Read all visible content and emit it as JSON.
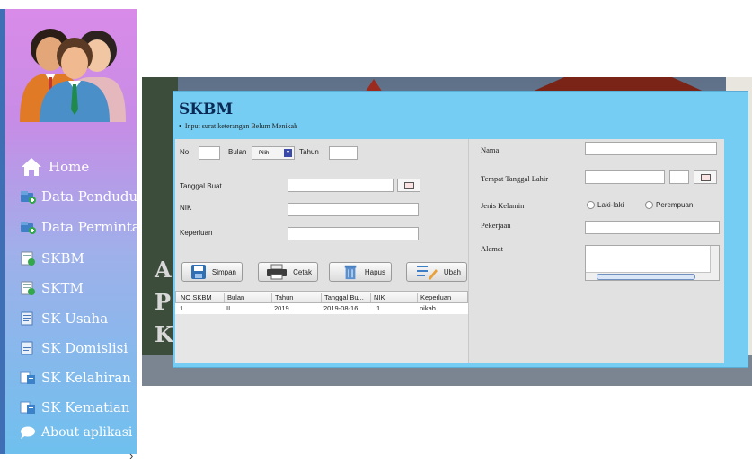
{
  "sidebar": {
    "items": [
      {
        "label": "Home",
        "icon": "home-icon"
      },
      {
        "label": "Data Penduduk",
        "icon": "add-user-icon"
      },
      {
        "label": "Data Permintaan",
        "icon": "add-request-icon"
      },
      {
        "label": "SKBM",
        "icon": "document-icon"
      },
      {
        "label": "SKTM",
        "icon": "document-icon"
      },
      {
        "label": "SK Usaha",
        "icon": "form-icon"
      },
      {
        "label": "SK Domislisi",
        "icon": "form-icon"
      },
      {
        "label": "SK Kelahiran",
        "icon": "birth-icon"
      },
      {
        "label": "SK Kematian",
        "icon": "death-icon"
      },
      {
        "label": "About aplikasi",
        "icon": "chat-bubble-icon"
      }
    ],
    "collapse_label": "›"
  },
  "background": {
    "letters": [
      "A",
      "P",
      "K"
    ]
  },
  "form": {
    "title": "SKBM",
    "subtitle": "Input surat keterangan Belum Menikah",
    "left": {
      "no_label": "No",
      "bulan_label": "Bulan",
      "bulan_value": "--Pilih--",
      "tahun_label": "Tahun",
      "tanggal_buat_label": "Tanggal Buat",
      "nik_label": "NIK",
      "keperluan_label": "Keperluan"
    },
    "right": {
      "nama_label": "Nama",
      "ttl_label": "Tempat Tanggal Lahir",
      "jenis_kelamin_label": "Jenis Kelamin",
      "gender_options": [
        "Laki-laki",
        "Perempuan"
      ],
      "pekerjaan_label": "Pekerjaan",
      "alamat_label": "Alamat"
    },
    "buttons": {
      "simpan": "Simpan",
      "cetak": "Cetak",
      "hapus": "Hapus",
      "ubah": "Ubah"
    },
    "table": {
      "headers": [
        "NO SKBM",
        "Bulan",
        "Tahun",
        "Tanggal Bu...",
        "NIK",
        "Keperluan"
      ],
      "rows": [
        [
          "1",
          "II",
          "2019",
          "2019-08-16",
          "1",
          "nikah"
        ]
      ]
    }
  }
}
